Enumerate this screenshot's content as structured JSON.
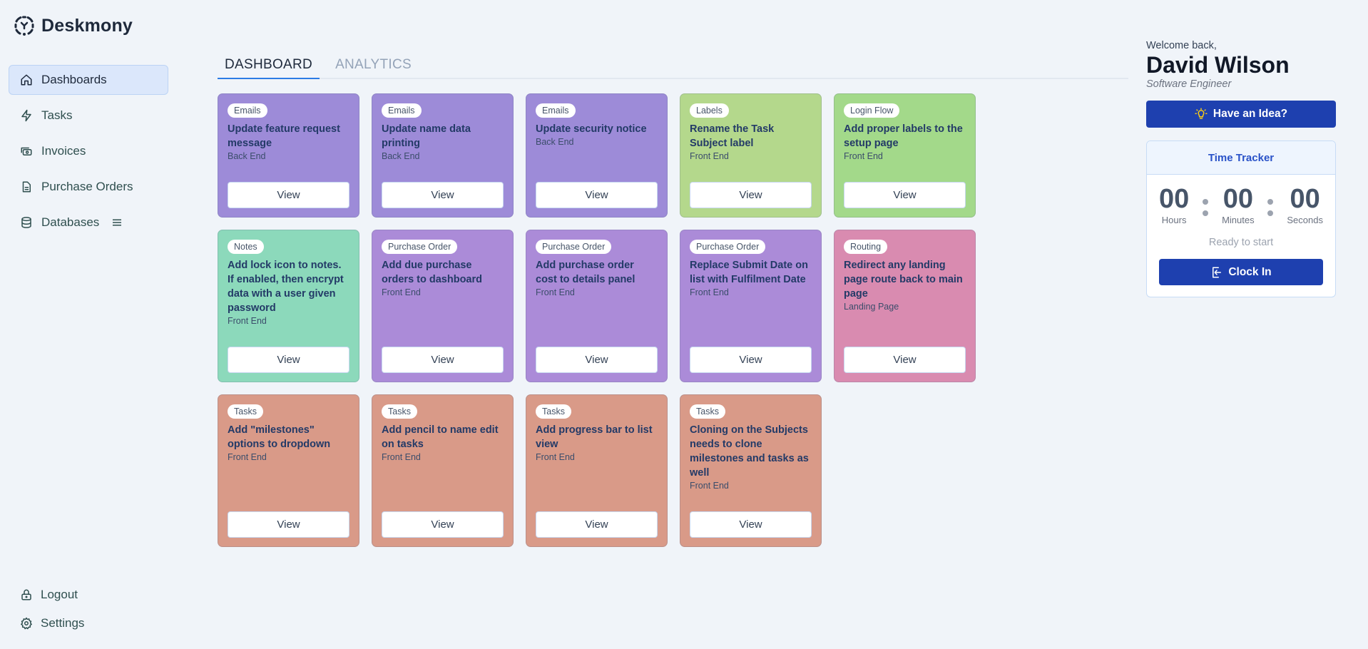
{
  "app": {
    "name": "Deskmony"
  },
  "sidebar": {
    "items": [
      {
        "label": "Dashboards",
        "icon": "home-icon",
        "active": true
      },
      {
        "label": "Tasks",
        "icon": "lightning-icon",
        "active": false
      },
      {
        "label": "Invoices",
        "icon": "cash-icon",
        "active": false
      },
      {
        "label": "Purchase Orders",
        "icon": "document-icon",
        "active": false
      },
      {
        "label": "Databases",
        "icon": "database-icon",
        "active": false,
        "extra_icon": "menu-icon"
      }
    ],
    "bottom": [
      {
        "label": "Logout",
        "icon": "lock-icon"
      },
      {
        "label": "Settings",
        "icon": "gear-icon"
      }
    ]
  },
  "tabs": [
    {
      "label": "DASHBOARD",
      "active": true
    },
    {
      "label": "ANALYTICS",
      "active": false
    }
  ],
  "colors": {
    "emails": "#9d8bd8",
    "labels": "#b4d88c",
    "login_flow": "#a3d98a",
    "notes": "#8cd9bb",
    "purchase_order": "#ab8bd8",
    "routing": "#d98bb0",
    "tasks": "#d99a88",
    "primary": "#1e40af",
    "tab_accent": "#2b7be4"
  },
  "cards": [
    {
      "tag": "Emails",
      "title": "Update feature request message",
      "subtitle": "Back End",
      "color_key": "emails",
      "button": "View"
    },
    {
      "tag": "Emails",
      "title": "Update name data printing",
      "subtitle": "Back End",
      "color_key": "emails",
      "button": "View"
    },
    {
      "tag": "Emails",
      "title": "Update security notice",
      "subtitle": "Back End",
      "color_key": "emails",
      "button": "View"
    },
    {
      "tag": "Labels",
      "title": "Rename the Task Subject label",
      "subtitle": "Front End",
      "color_key": "labels",
      "button": "View"
    },
    {
      "tag": "Login Flow",
      "title": "Add proper labels to the setup page",
      "subtitle": "Front End",
      "color_key": "login_flow",
      "button": "View"
    },
    {
      "tag": "Notes",
      "title": "Add lock icon to notes. If enabled, then encrypt data with a user given password",
      "subtitle": "Front End",
      "color_key": "notes",
      "button": "View"
    },
    {
      "tag": "Purchase Order",
      "title": "Add due purchase orders to dashboard",
      "subtitle": "Front End",
      "color_key": "purchase_order",
      "button": "View"
    },
    {
      "tag": "Purchase Order",
      "title": "Add purchase order cost to details panel",
      "subtitle": "Front End",
      "color_key": "purchase_order",
      "button": "View"
    },
    {
      "tag": "Purchase Order",
      "title": "Replace Submit Date on list with Fulfilment Date",
      "subtitle": "Front End",
      "color_key": "purchase_order",
      "button": "View"
    },
    {
      "tag": "Routing",
      "title": "Redirect any landing page route back to main page",
      "subtitle": "Landing Page",
      "color_key": "routing",
      "button": "View"
    },
    {
      "tag": "Tasks",
      "title": "Add \"milestones\" options to dropdown",
      "subtitle": "Front End",
      "color_key": "tasks",
      "button": "View"
    },
    {
      "tag": "Tasks",
      "title": "Add pencil to name edit on tasks",
      "subtitle": "Front End",
      "color_key": "tasks",
      "button": "View"
    },
    {
      "tag": "Tasks",
      "title": "Add progress bar to list view",
      "subtitle": "Front End",
      "color_key": "tasks",
      "button": "View"
    },
    {
      "tag": "Tasks",
      "title": "Cloning on the Subjects needs to clone milestones and tasks as well",
      "subtitle": "Front End",
      "color_key": "tasks",
      "button": "View"
    }
  ],
  "user": {
    "greeting": "Welcome back,",
    "name": "David Wilson",
    "role": "Software Engineer"
  },
  "idea_button": {
    "label": "Have an Idea?",
    "icon": "lightbulb-icon"
  },
  "time_tracker": {
    "title": "Time Tracker",
    "hours": "00",
    "minutes": "00",
    "seconds": "00",
    "hours_label": "Hours",
    "minutes_label": "Minutes",
    "seconds_label": "Seconds",
    "status": "Ready to start",
    "button": "Clock In",
    "button_icon": "login-icon"
  }
}
